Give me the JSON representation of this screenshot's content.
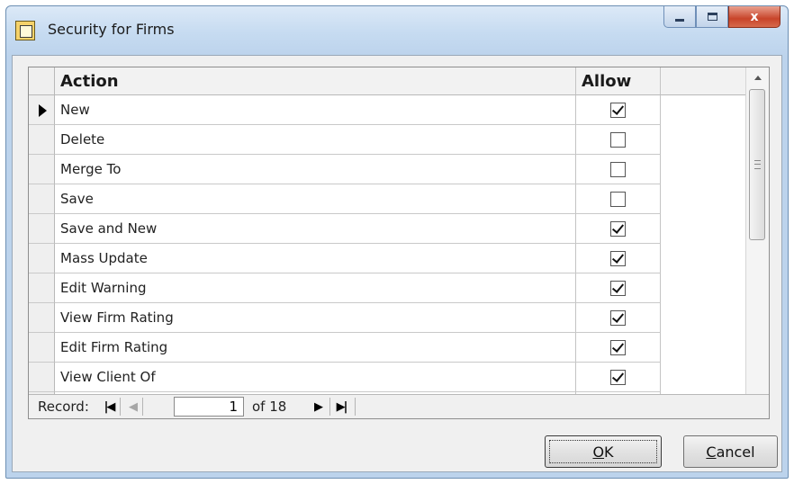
{
  "window": {
    "title": "Security for Firms",
    "close_glyph": "x"
  },
  "grid": {
    "columns": {
      "action": "Action",
      "allow": "Allow"
    },
    "rows": [
      {
        "action": "New",
        "allow": true,
        "current": true
      },
      {
        "action": "Delete",
        "allow": false
      },
      {
        "action": "Merge To",
        "allow": false
      },
      {
        "action": "Save",
        "allow": false
      },
      {
        "action": "Save and New",
        "allow": true
      },
      {
        "action": "Mass Update",
        "allow": true
      },
      {
        "action": "Edit Warning",
        "allow": true
      },
      {
        "action": "View Firm Rating",
        "allow": true
      },
      {
        "action": "Edit Firm Rating",
        "allow": true
      },
      {
        "action": "View Client Of",
        "allow": true
      }
    ]
  },
  "navigator": {
    "label": "Record:",
    "first": "|◀",
    "prev": "◀",
    "current": "1",
    "total_text": "of 18",
    "next": "▶",
    "last": "▶|"
  },
  "buttons": {
    "ok_underlined": "O",
    "ok_rest": "K",
    "cancel_underlined": "C",
    "cancel_rest": "ancel"
  }
}
